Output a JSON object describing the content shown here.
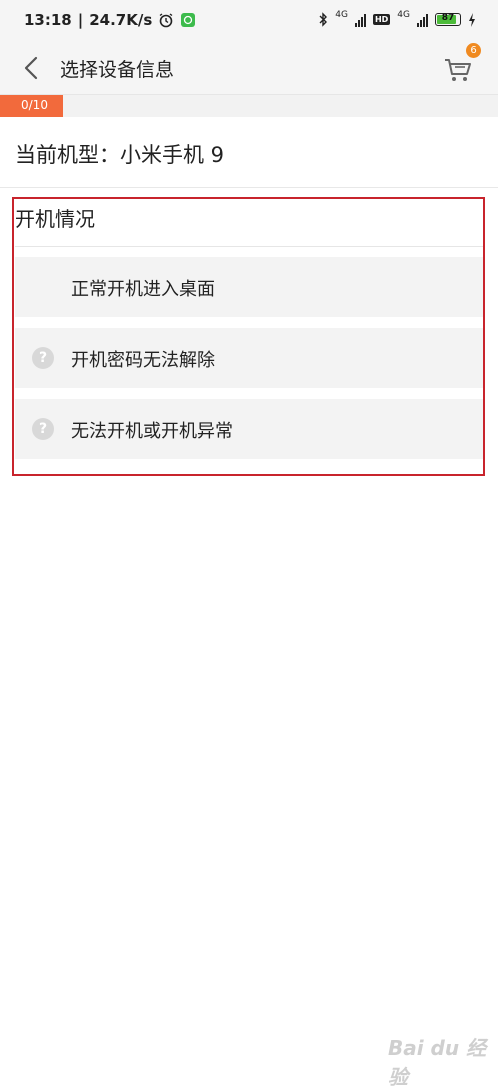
{
  "status_bar": {
    "time": "13:18",
    "network_speed": "24.7K/s",
    "signal1_label": "4G",
    "hd_label": "HD",
    "signal2_label": "4G",
    "battery": "87"
  },
  "header": {
    "title": "选择设备信息",
    "cart_badge": "6"
  },
  "progress": {
    "text": "0/10",
    "value": 0,
    "total": 10
  },
  "device": {
    "model_line": "当前机型：小米手机 9"
  },
  "section": {
    "title": "开机情况",
    "options": [
      {
        "label": "正常开机进入桌面",
        "has_help_icon": false
      },
      {
        "label": "开机密码无法解除",
        "has_help_icon": true
      },
      {
        "label": "无法开机或开机异常",
        "has_help_icon": true
      }
    ]
  },
  "watermark": "Bai du 经验",
  "colors": {
    "accent": "#f26a3c",
    "badge": "#f08a20",
    "highlight_border": "#c8242c"
  }
}
